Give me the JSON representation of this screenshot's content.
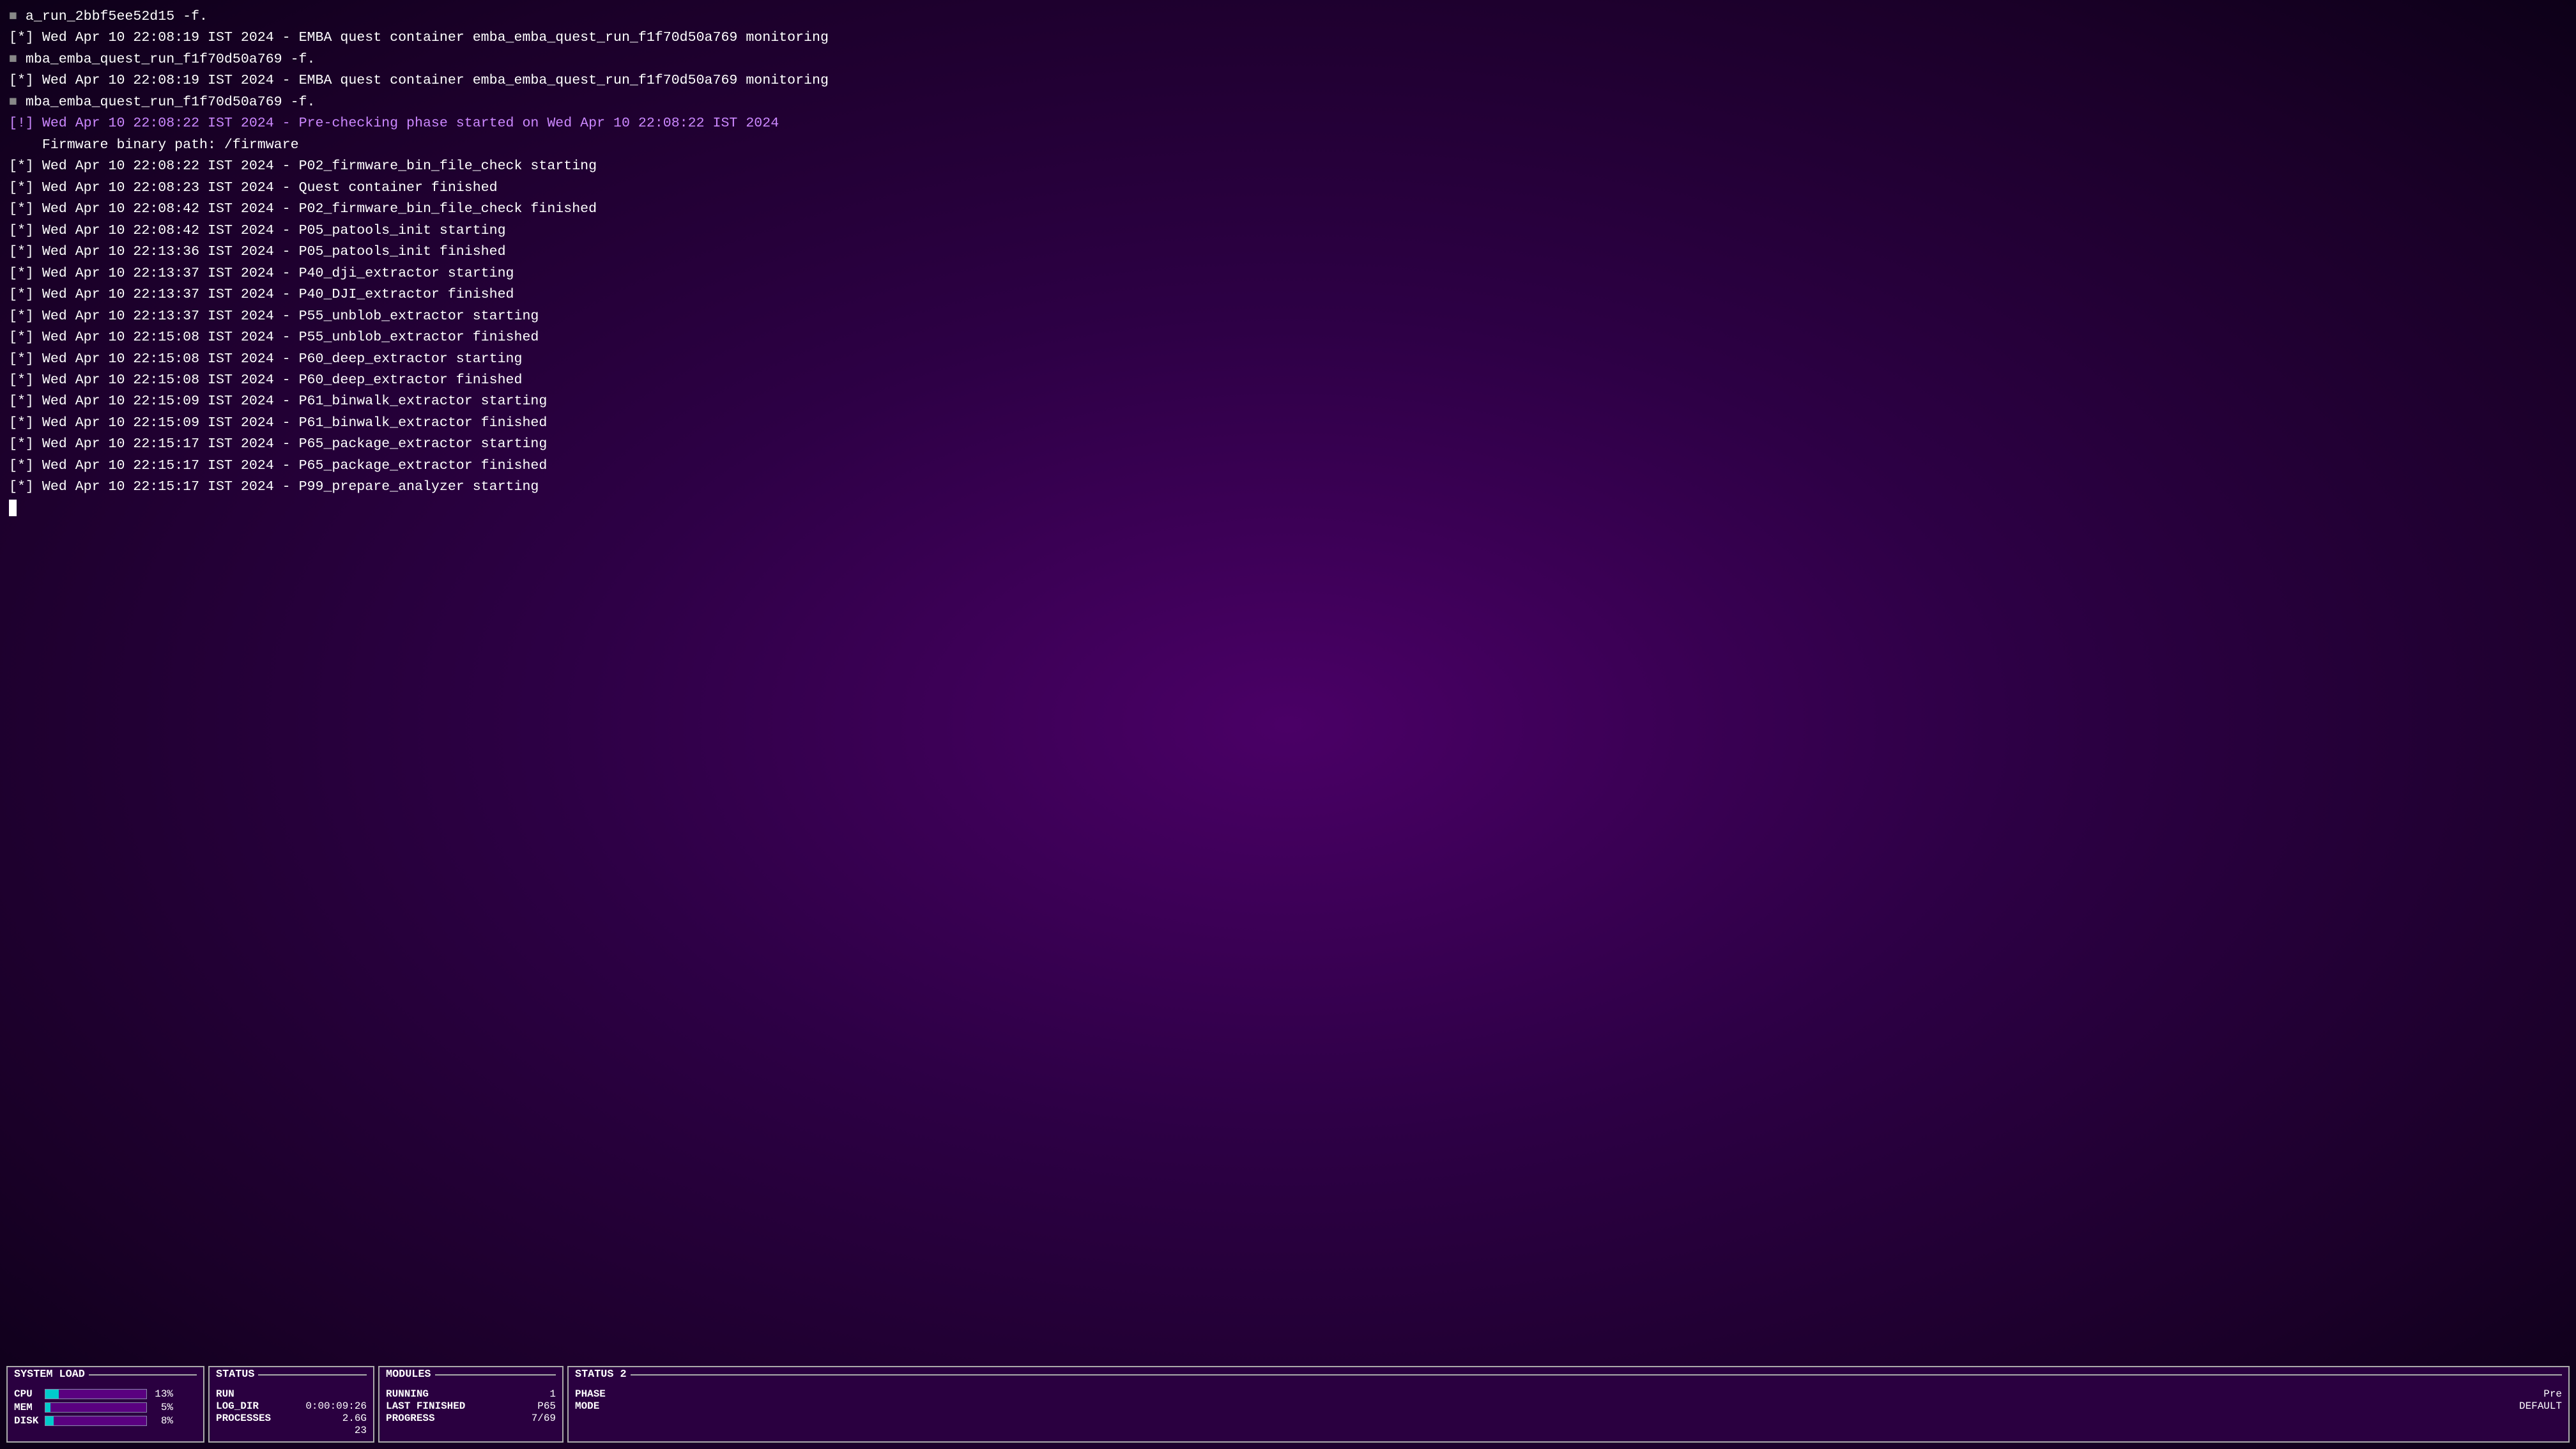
{
  "terminal": {
    "lines": [
      {
        "id": 1,
        "type": "checkbox",
        "prefix": "■",
        "content": "a_run_2bbf5ee52d15 -f."
      },
      {
        "id": 2,
        "type": "star",
        "prefix": "[*]",
        "timestamp": "Wed Apr 10 22:08:19 IST 2024",
        "message": "EMBA quest container emba_emba_quest_run_f1f70d50a769 monitoring"
      },
      {
        "id": 3,
        "type": "checkbox",
        "prefix": "■",
        "content": "mba_emba_quest_run_f1f70d50a769 -f."
      },
      {
        "id": 4,
        "type": "star",
        "prefix": "[*]",
        "timestamp": "Wed Apr 10 22:08:19 IST 2024",
        "message": "EMBA quest container emba_emba_quest_run_f1f70d50a769 monitoring"
      },
      {
        "id": 5,
        "type": "checkbox",
        "prefix": "■",
        "content": "mba_emba_quest_run_f1f70d50a769 -f."
      },
      {
        "id": 6,
        "type": "bang",
        "prefix": "[!]",
        "timestamp": "Wed Apr 10 22:08:22 IST 2024",
        "message": "Pre-checking phase started on Wed Apr 10 22:08:22 IST 2024"
      },
      {
        "id": 7,
        "type": "plain",
        "content": "    Firmware binary path: /firmware"
      },
      {
        "id": 8,
        "type": "star",
        "prefix": "[*]",
        "timestamp": "Wed Apr 10 22:08:22 IST 2024",
        "message": "P02_firmware_bin_file_check starting"
      },
      {
        "id": 9,
        "type": "star",
        "prefix": "[*]",
        "timestamp": "Wed Apr 10 22:08:23 IST 2024",
        "message": "Quest container finished"
      },
      {
        "id": 10,
        "type": "star",
        "prefix": "[*]",
        "timestamp": "Wed Apr 10 22:08:42 IST 2024",
        "message": "P02_firmware_bin_file_check finished"
      },
      {
        "id": 11,
        "type": "star",
        "prefix": "[*]",
        "timestamp": "Wed Apr 10 22:08:42 IST 2024",
        "message": "P05_patools_init starting"
      },
      {
        "id": 12,
        "type": "star",
        "prefix": "[*]",
        "timestamp": "Wed Apr 10 22:13:36 IST 2024",
        "message": "P05_patools_init finished"
      },
      {
        "id": 13,
        "type": "star",
        "prefix": "[*]",
        "timestamp": "Wed Apr 10 22:13:37 IST 2024",
        "message": "P40_dji_extractor starting"
      },
      {
        "id": 14,
        "type": "star",
        "prefix": "[*]",
        "timestamp": "Wed Apr 10 22:13:37 IST 2024",
        "message": "P40_DJI_extractor finished"
      },
      {
        "id": 15,
        "type": "star",
        "prefix": "[*]",
        "timestamp": "Wed Apr 10 22:13:37 IST 2024",
        "message": "P55_unblob_extractor starting"
      },
      {
        "id": 16,
        "type": "star",
        "prefix": "[*]",
        "timestamp": "Wed Apr 10 22:15:08 IST 2024",
        "message": "P55_unblob_extractor finished"
      },
      {
        "id": 17,
        "type": "star",
        "prefix": "[*]",
        "timestamp": "Wed Apr 10 22:15:08 IST 2024",
        "message": "P60_deep_extractor starting"
      },
      {
        "id": 18,
        "type": "star",
        "prefix": "[*]",
        "timestamp": "Wed Apr 10 22:15:08 IST 2024",
        "message": "P60_deep_extractor finished"
      },
      {
        "id": 19,
        "type": "star",
        "prefix": "[*]",
        "timestamp": "Wed Apr 10 22:15:09 IST 2024",
        "message": "P61_binwalk_extractor starting"
      },
      {
        "id": 20,
        "type": "star",
        "prefix": "[*]",
        "timestamp": "Wed Apr 10 22:15:09 IST 2024",
        "message": "P61_binwalk_extractor finished"
      },
      {
        "id": 21,
        "type": "star",
        "prefix": "[*]",
        "timestamp": "Wed Apr 10 22:15:17 IST 2024",
        "message": "P65_package_extractor starting"
      },
      {
        "id": 22,
        "type": "star",
        "prefix": "[*]",
        "timestamp": "Wed Apr 10 22:15:17 IST 2024",
        "message": "P65_package_extractor finished"
      },
      {
        "id": 23,
        "type": "star",
        "prefix": "[*]",
        "timestamp": "Wed Apr 10 22:15:17 IST 2024",
        "message": "P99_prepare_analyzer starting"
      }
    ],
    "cursor": true
  },
  "statusBar": {
    "systemLoad": {
      "title": "SYSTEM LOAD",
      "cpu": {
        "label": "CPU",
        "percent": 13,
        "display": "13%"
      },
      "mem": {
        "label": "MEM",
        "percent": 5,
        "display": "5%"
      },
      "disk": {
        "label": "DISK",
        "percent": 8,
        "display": "8%"
      }
    },
    "status": {
      "title": "STATUS",
      "run": {
        "key": "RUN",
        "value": ""
      },
      "logDir": {
        "key": "LOG_DIR",
        "value": "0:00:09:26"
      },
      "processes": {
        "key": "PROCESSES",
        "value": "2.6G"
      },
      "processCount": "23"
    },
    "modules": {
      "title": "MODULES",
      "running": {
        "key": "RUNNING",
        "value": "1"
      },
      "lastFinished": {
        "key": "LAST FINISHED",
        "value": "P65"
      },
      "progress": {
        "key": "PROGRESS",
        "value": "7/69"
      }
    },
    "status2": {
      "title": "STATUS 2",
      "phase": {
        "key": "PHASE",
        "value": "Pre"
      },
      "mode": {
        "key": "MODE",
        "value": "DEFAULT"
      }
    }
  },
  "icons": {
    "checkbox": "■",
    "cursor": "█"
  }
}
